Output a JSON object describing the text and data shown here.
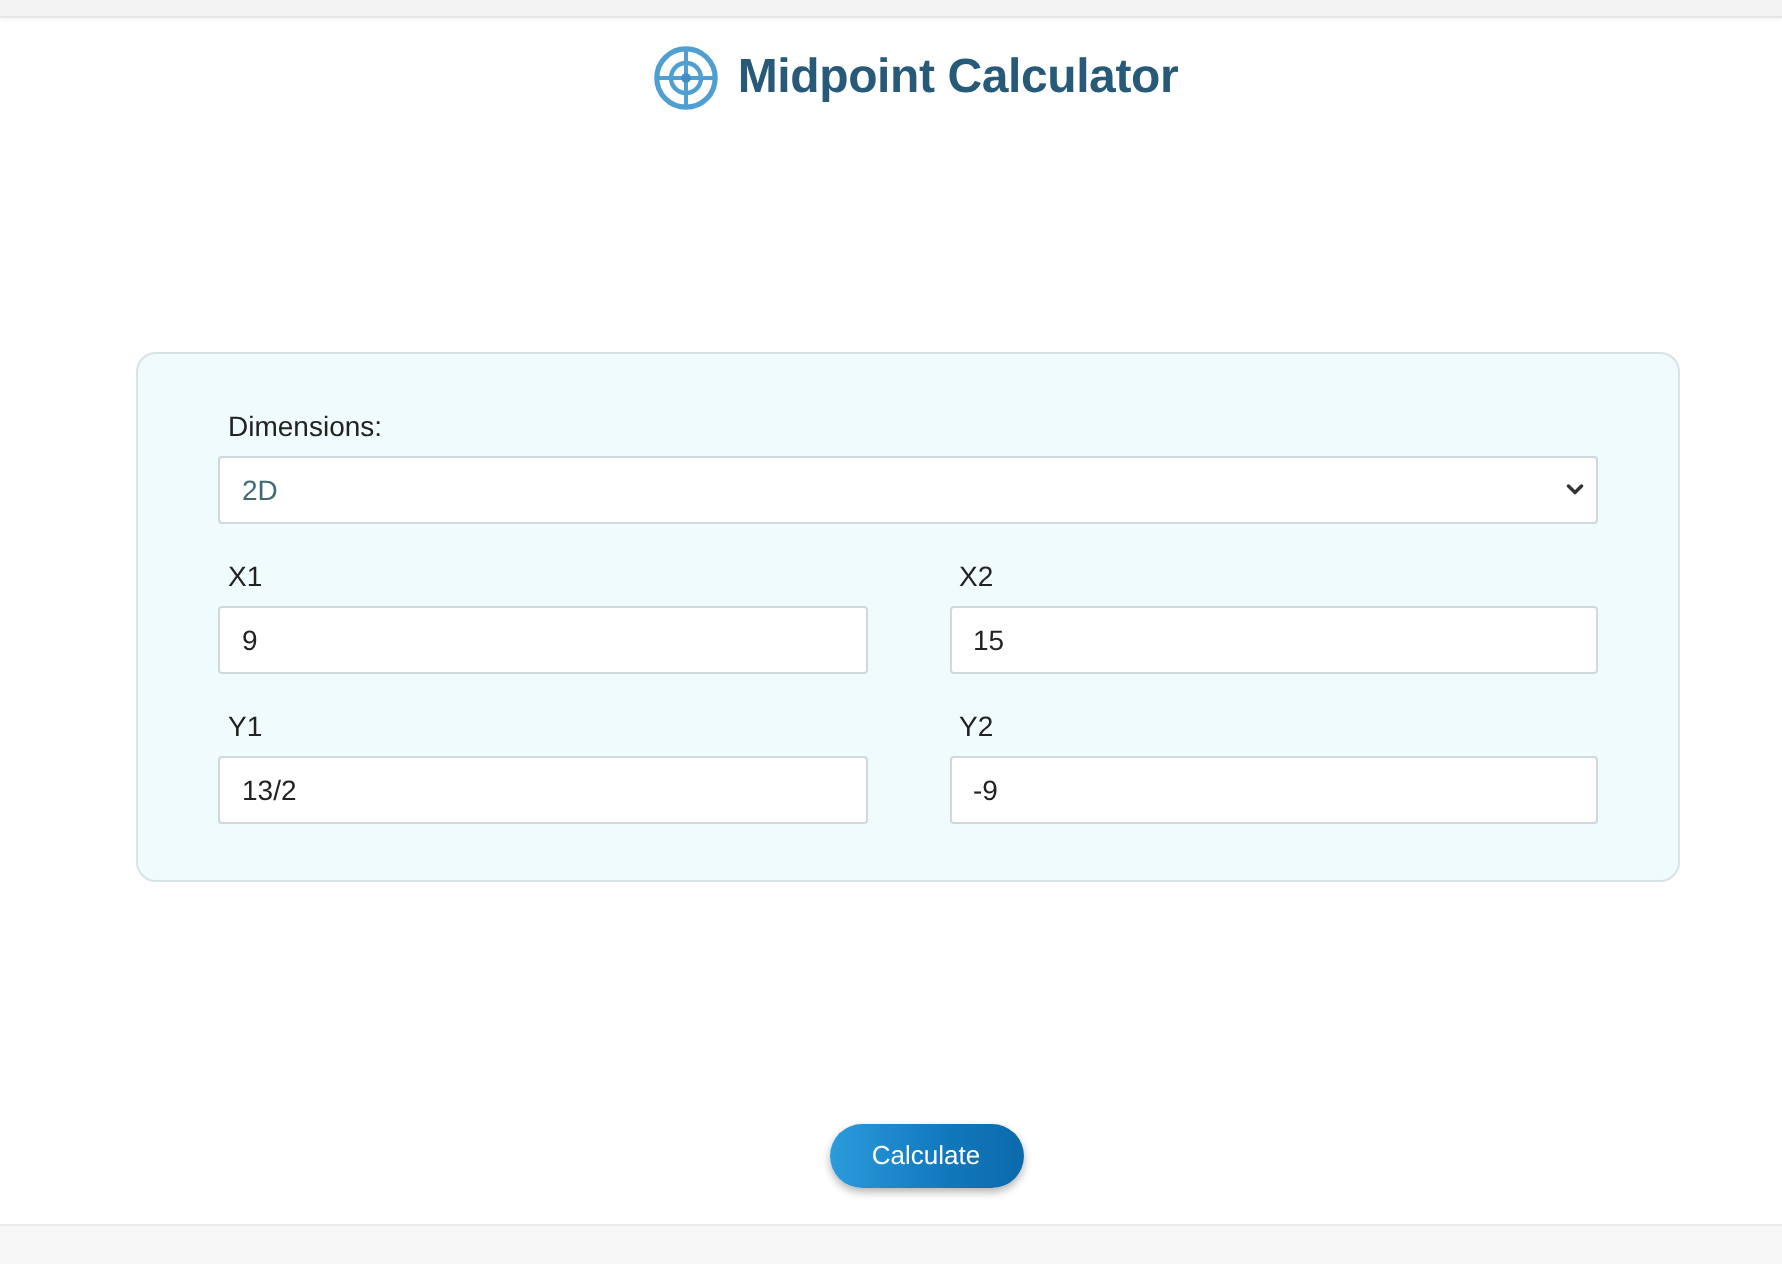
{
  "header": {
    "title": "Midpoint Calculator"
  },
  "form": {
    "dimensions": {
      "label": "Dimensions:",
      "value": "2D"
    },
    "fields": [
      {
        "label": "X1",
        "value": "9"
      },
      {
        "label": "X2",
        "value": "15"
      },
      {
        "label": "Y1",
        "value": "13/2"
      },
      {
        "label": "Y2",
        "value": "-9"
      }
    ]
  },
  "buttons": [
    {
      "label": "Calculate"
    }
  ]
}
